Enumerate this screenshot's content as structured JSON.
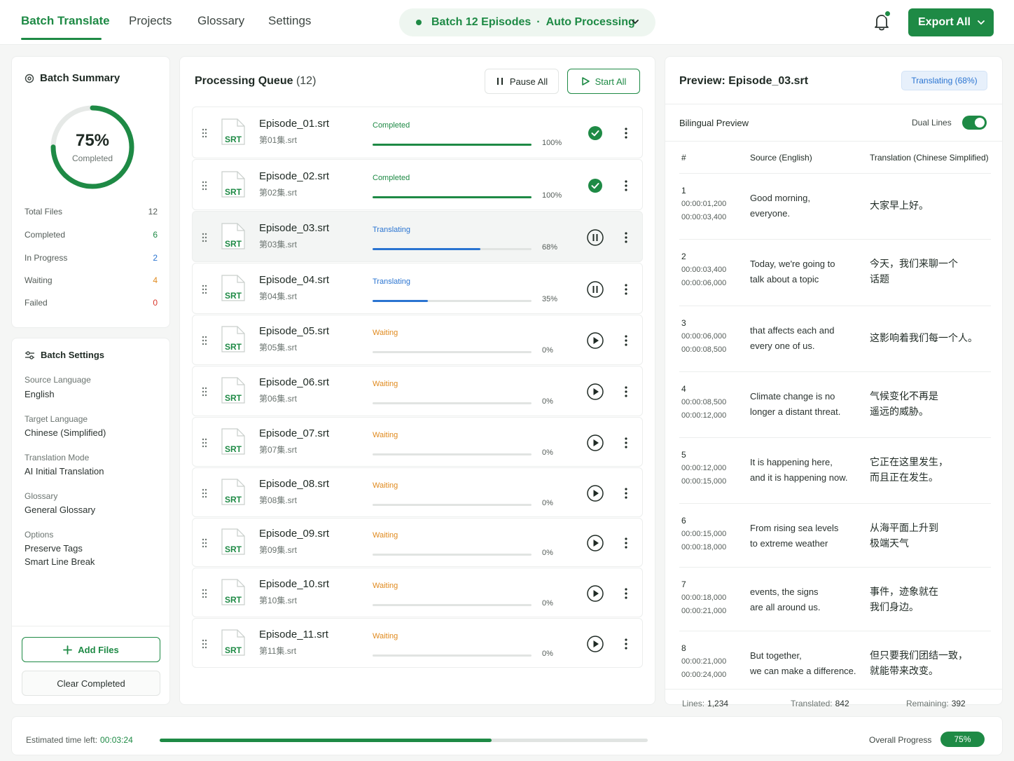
{
  "nav": {
    "tabs": [
      {
        "label": "Batch Translate",
        "active": true
      },
      {
        "label": "Projects",
        "active": false
      },
      {
        "label": "Glossary",
        "active": false
      },
      {
        "label": "Settings",
        "active": false
      }
    ],
    "status": {
      "batch": "Batch 12 Episodes",
      "separator": "·",
      "mode": "Auto Processing"
    },
    "export_label": "Export All"
  },
  "summary": {
    "title": "Batch Summary",
    "percent_label": "75%",
    "percent_value": 0.75,
    "completed_label": "Completed",
    "stats": [
      {
        "label": "Total Files",
        "value": "12",
        "color": "#545c58"
      },
      {
        "label": "Completed",
        "value": "6",
        "color": "#1e8a45"
      },
      {
        "label": "In Progress",
        "value": "2",
        "color": "#2a74d1"
      },
      {
        "label": "Waiting",
        "value": "4",
        "color": "#e08a1e"
      },
      {
        "label": "Failed",
        "value": "0",
        "color": "#d9372b"
      }
    ]
  },
  "settings": {
    "title": "Batch Settings",
    "source_label": "Source Language",
    "source_value": "English",
    "target_label": "Target Language",
    "target_value": "Chinese (Simplified)",
    "mode_label": "Translation Mode",
    "mode_value": "AI Initial Translation",
    "glossary_label": "Glossary",
    "glossary_value": "General Glossary",
    "options_label": "Options",
    "options_values": [
      "Preserve Tags",
      "Smart Line Break"
    ],
    "add_files": "Add Files",
    "clear_completed": "Clear Completed"
  },
  "queue": {
    "title": "Processing Queue",
    "count": "(12)",
    "pause_all": "Pause All",
    "start_all": "Start All",
    "badge": "SRT",
    "items": [
      {
        "name": "Episode_01.srt",
        "sub": "第01集.srt",
        "status": "Completed",
        "progress": 1.0,
        "pct": "100%",
        "action": "completed"
      },
      {
        "name": "Episode_02.srt",
        "sub": "第02集.srt",
        "status": "Completed",
        "progress": 1.0,
        "pct": "100%",
        "action": "completed"
      },
      {
        "name": "Episode_03.srt",
        "sub": "第03集.srt",
        "status": "Translating",
        "progress": 0.68,
        "pct": "68%",
        "action": "pause"
      },
      {
        "name": "Episode_04.srt",
        "sub": "第04集.srt",
        "status": "Translating",
        "progress": 0.35,
        "pct": "35%",
        "action": "pause"
      },
      {
        "name": "Episode_05.srt",
        "sub": "第05集.srt",
        "status": "Waiting",
        "progress": 0,
        "pct": "0%",
        "action": "play"
      },
      {
        "name": "Episode_06.srt",
        "sub": "第06集.srt",
        "status": "Waiting",
        "progress": 0,
        "pct": "0%",
        "action": "play"
      },
      {
        "name": "Episode_07.srt",
        "sub": "第07集.srt",
        "status": "Waiting",
        "progress": 0,
        "pct": "0%",
        "action": "play"
      },
      {
        "name": "Episode_08.srt",
        "sub": "第08集.srt",
        "status": "Waiting",
        "progress": 0,
        "pct": "0%",
        "action": "play"
      },
      {
        "name": "Episode_09.srt",
        "sub": "第09集.srt",
        "status": "Waiting",
        "progress": 0,
        "pct": "0%",
        "action": "play"
      },
      {
        "name": "Episode_10.srt",
        "sub": "第10集.srt",
        "status": "Waiting",
        "progress": 0,
        "pct": "0%",
        "action": "play"
      },
      {
        "name": "Episode_11.srt",
        "sub": "第11集.srt",
        "status": "Waiting",
        "progress": 0,
        "pct": "0%",
        "action": "play"
      }
    ]
  },
  "preview": {
    "title": "Preview: Episode_03.srt",
    "badge": "Translating (68%)",
    "subtitle": "Bilingual Preview",
    "dual_lines": "Dual Lines",
    "dual_on": true,
    "headers": {
      "num": "#",
      "source": "Source (English)",
      "translation": "Translation (Chinese Simplified)"
    },
    "rows": [
      {
        "num": "1",
        "start": "00:00:01,200",
        "end": "00:00:03,400",
        "src": [
          "Good morning,",
          "everyone."
        ],
        "tr": [
          "大家早上好。"
        ]
      },
      {
        "num": "2",
        "start": "00:00:03,400",
        "end": "00:00:06,000",
        "src": [
          "Today, we're going to",
          "talk about a topic"
        ],
        "tr": [
          "今天，我们来聊一个",
          "话题"
        ]
      },
      {
        "num": "3",
        "start": "00:00:06,000",
        "end": "00:00:08,500",
        "src": [
          "that affects each and",
          "every one of us."
        ],
        "tr": [
          "这影响着我们每一个人。"
        ]
      },
      {
        "num": "4",
        "start": "00:00:08,500",
        "end": "00:00:12,000",
        "src": [
          "Climate change is no",
          "longer a distant threat."
        ],
        "tr": [
          "气候变化不再是",
          "遥远的威胁。"
        ]
      },
      {
        "num": "5",
        "start": "00:00:12,000",
        "end": "00:00:15,000",
        "src": [
          "It is happening here,",
          "and it is happening now."
        ],
        "tr": [
          "它正在这里发生，",
          "而且正在发生。"
        ]
      },
      {
        "num": "6",
        "start": "00:00:15,000",
        "end": "00:00:18,000",
        "src": [
          "From rising sea levels",
          "to extreme weather"
        ],
        "tr": [
          "从海平面上升到",
          "极端天气"
        ]
      },
      {
        "num": "7",
        "start": "00:00:18,000",
        "end": "00:00:21,000",
        "src": [
          "events, the signs",
          "are all around us."
        ],
        "tr": [
          "事件，迹象就在",
          "我们身边。"
        ]
      },
      {
        "num": "8",
        "start": "00:00:21,000",
        "end": "00:00:24,000",
        "src": [
          "But together,",
          "we can make a difference."
        ],
        "tr": [
          "但只要我们团结一致，",
          "就能带来改变。"
        ]
      }
    ],
    "footer": {
      "lines_label": "Lines:",
      "lines": "1,234",
      "translated_label": "Translated:",
      "translated": "842",
      "remaining_label": "Remaining:",
      "remaining": "392"
    }
  },
  "bottom": {
    "eta_label": "Estimated time left:",
    "eta": "00:03:24",
    "progress": 0.68,
    "overall_label": "Overall Progress",
    "overall": "75%"
  },
  "colors": {
    "accent": "#1e8a45",
    "translating": "#2a74d1",
    "waiting": "#e08a1e",
    "failed": "#d9372b"
  }
}
